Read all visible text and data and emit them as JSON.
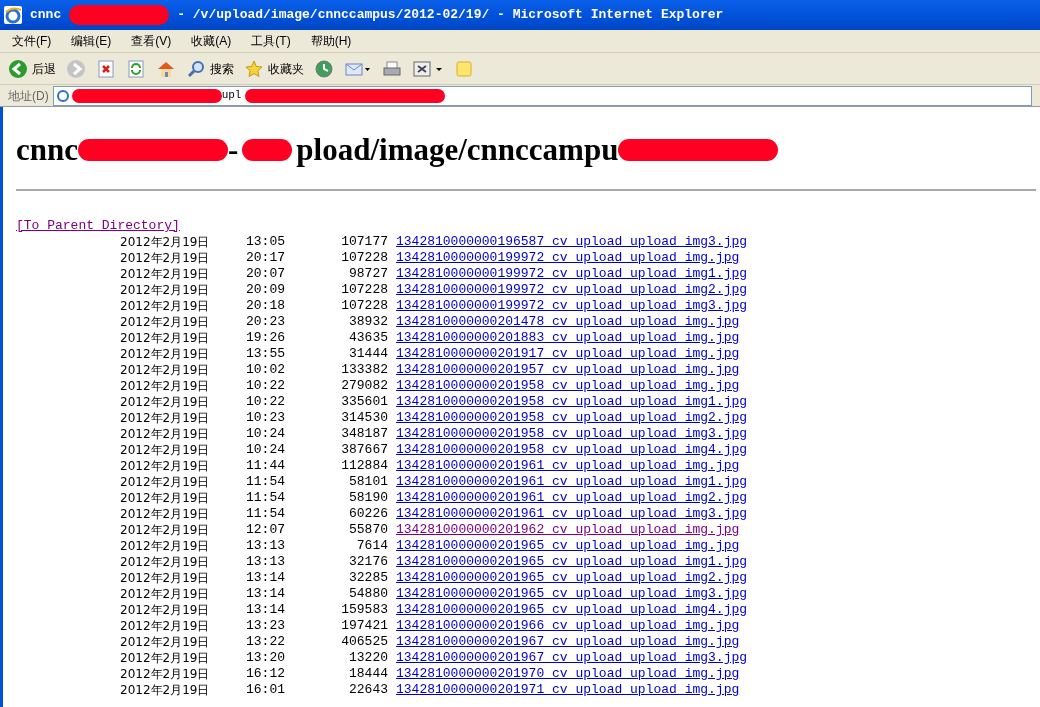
{
  "window": {
    "title_parts": [
      {
        "kind": "text",
        "text": "cnnc"
      },
      {
        "kind": "redaction"
      },
      {
        "kind": "text",
        "text": "- /v/upload/image/cnnccampus/2012-02/19/ - Microsoft Internet Explorer"
      }
    ]
  },
  "menu": [
    "文件(F)",
    "编辑(E)",
    "查看(V)",
    "收藏(A)",
    "工具(T)",
    "帮助(H)"
  ],
  "toolbar": [
    {
      "kind": "back",
      "label": "后退",
      "disabled": false
    },
    {
      "kind": "forward",
      "disabled": true
    },
    {
      "kind": "stop"
    },
    {
      "kind": "refresh"
    },
    {
      "kind": "home"
    },
    {
      "kind": "search",
      "label": "搜索"
    },
    {
      "kind": "favorites",
      "label": "收藏夹"
    },
    {
      "kind": "history"
    },
    {
      "kind": "mail"
    },
    {
      "kind": "print"
    },
    {
      "kind": "edit"
    },
    {
      "kind": "note"
    }
  ],
  "address": {
    "label": "地址(D)",
    "parts": [
      {
        "kind": "redaction"
      },
      {
        "kind": "text",
        "text": "upl"
      },
      {
        "kind": "redaction"
      }
    ]
  },
  "heading_parts": [
    {
      "kind": "text",
      "text": "cnnc"
    },
    {
      "kind": "redaction"
    },
    {
      "kind": "text",
      "text": "-"
    },
    {
      "kind": "redaction"
    },
    {
      "kind": "text",
      "text": "pload/image/cnnccampu"
    },
    {
      "kind": "redaction"
    }
  ],
  "parent_link": "[To Parent Directory]",
  "files": [
    {
      "date": "2012年2月19日",
      "time": "13:05",
      "size": "107177",
      "name": "1342810000000196587_cv_upload_upload_img3.jpg",
      "visited": false
    },
    {
      "date": "2012年2月19日",
      "time": "20:17",
      "size": "107228",
      "name": "1342810000000199972_cv_upload_upload_img.jpg",
      "visited": false
    },
    {
      "date": "2012年2月19日",
      "time": "20:07",
      "size": "98727",
      "name": "1342810000000199972_cv_upload_upload_img1.jpg",
      "visited": false
    },
    {
      "date": "2012年2月19日",
      "time": "20:09",
      "size": "107228",
      "name": "1342810000000199972_cv_upload_upload_img2.jpg",
      "visited": false
    },
    {
      "date": "2012年2月19日",
      "time": "20:18",
      "size": "107228",
      "name": "1342810000000199972_cv_upload_upload_img3.jpg",
      "visited": false
    },
    {
      "date": "2012年2月19日",
      "time": "20:23",
      "size": "38932",
      "name": "1342810000000201478_cv_upload_upload_img.jpg",
      "visited": false
    },
    {
      "date": "2012年2月19日",
      "time": "19:26",
      "size": "43635",
      "name": "1342810000000201883_cv_upload_upload_img.jpg",
      "visited": false
    },
    {
      "date": "2012年2月19日",
      "time": "13:55",
      "size": "31444",
      "name": "1342810000000201917_cv_upload_upload_img.jpg",
      "visited": false
    },
    {
      "date": "2012年2月19日",
      "time": "10:02",
      "size": "133382",
      "name": "1342810000000201957_cv_upload_upload_img.jpg",
      "visited": false
    },
    {
      "date": "2012年2月19日",
      "time": "10:22",
      "size": "279082",
      "name": "1342810000000201958_cv_upload_upload_img.jpg",
      "visited": false
    },
    {
      "date": "2012年2月19日",
      "time": "10:22",
      "size": "335601",
      "name": "1342810000000201958_cv_upload_upload_img1.jpg",
      "visited": false
    },
    {
      "date": "2012年2月19日",
      "time": "10:23",
      "size": "314530",
      "name": "1342810000000201958_cv_upload_upload_img2.jpg",
      "visited": false
    },
    {
      "date": "2012年2月19日",
      "time": "10:24",
      "size": "348187",
      "name": "1342810000000201958_cv_upload_upload_img3.jpg",
      "visited": false
    },
    {
      "date": "2012年2月19日",
      "time": "10:24",
      "size": "387667",
      "name": "1342810000000201958_cv_upload_upload_img4.jpg",
      "visited": false
    },
    {
      "date": "2012年2月19日",
      "time": "11:44",
      "size": "112884",
      "name": "1342810000000201961_cv_upload_upload_img.jpg",
      "visited": false
    },
    {
      "date": "2012年2月19日",
      "time": "11:54",
      "size": "58101",
      "name": "1342810000000201961_cv_upload_upload_img1.jpg",
      "visited": false
    },
    {
      "date": "2012年2月19日",
      "time": "11:54",
      "size": "58190",
      "name": "1342810000000201961_cv_upload_upload_img2.jpg",
      "visited": false
    },
    {
      "date": "2012年2月19日",
      "time": "11:54",
      "size": "60226",
      "name": "1342810000000201961_cv_upload_upload_img3.jpg",
      "visited": false
    },
    {
      "date": "2012年2月19日",
      "time": "12:07",
      "size": "55870",
      "name": "1342810000000201962_cv_upload_upload_img.jpg",
      "visited": true
    },
    {
      "date": "2012年2月19日",
      "time": "13:13",
      "size": "7614",
      "name": "1342810000000201965_cv_upload_upload_img.jpg",
      "visited": false
    },
    {
      "date": "2012年2月19日",
      "time": "13:13",
      "size": "32176",
      "name": "1342810000000201965_cv_upload_upload_img1.jpg",
      "visited": false
    },
    {
      "date": "2012年2月19日",
      "time": "13:14",
      "size": "32285",
      "name": "1342810000000201965_cv_upload_upload_img2.jpg",
      "visited": false
    },
    {
      "date": "2012年2月19日",
      "time": "13:14",
      "size": "54880",
      "name": "1342810000000201965_cv_upload_upload_img3.jpg",
      "visited": false
    },
    {
      "date": "2012年2月19日",
      "time": "13:14",
      "size": "159583",
      "name": "1342810000000201965_cv_upload_upload_img4.jpg",
      "visited": false
    },
    {
      "date": "2012年2月19日",
      "time": "13:23",
      "size": "197421",
      "name": "1342810000000201966_cv_upload_upload_img.jpg",
      "visited": false
    },
    {
      "date": "2012年2月19日",
      "time": "13:22",
      "size": "406525",
      "name": "1342810000000201967_cv_upload_upload_img.jpg",
      "visited": false
    },
    {
      "date": "2012年2月19日",
      "time": "13:20",
      "size": "13220",
      "name": "1342810000000201967_cv_upload_upload_img3.jpg",
      "visited": false
    },
    {
      "date": "2012年2月19日",
      "time": "16:12",
      "size": "18444",
      "name": "1342810000000201970_cv_upload_upload_img.jpg",
      "visited": false
    },
    {
      "date": "2012年2月19日",
      "time": "16:01",
      "size": "22643",
      "name": "1342810000000201971_cv_upload_upload_img.jpg",
      "visited": false
    }
  ]
}
